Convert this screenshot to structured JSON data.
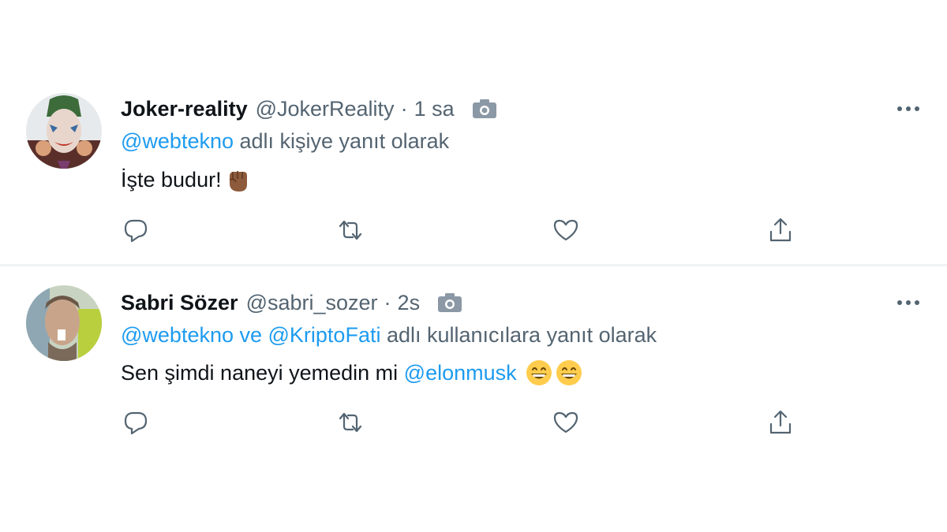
{
  "colors": {
    "link": "#1d9bf0",
    "secondary_text": "#536471",
    "primary_text": "#0f1419",
    "divider": "#eff3f4"
  },
  "tweets": [
    {
      "display_name": "Joker-reality",
      "handle": "@JokerReality",
      "separator": "·",
      "time": "1 sa",
      "reply_mentions": "@webtekno",
      "reply_suffix": " adlı kişiye yanıt olarak",
      "text": "İşte budur!",
      "text_mention": "",
      "emojis": [
        "raised-fist-medium-dark-skin"
      ],
      "icons": [
        "camera-icon",
        "more-icon",
        "reply-icon",
        "retweet-icon",
        "like-icon",
        "share-icon"
      ]
    },
    {
      "display_name": "Sabri Sözer",
      "handle": "@sabri_sozer",
      "separator": "·",
      "time": "2s",
      "reply_mentions": "@webtekno ve @KriptoFati",
      "reply_suffix": " adlı kullanıcılara yanıt olarak",
      "text": "Sen şimdi naneyi yemedin mi ",
      "text_mention": "@elonmusk",
      "emojis": [
        "grinning-face-smiling-eyes",
        "grinning-face-smiling-eyes"
      ],
      "icons": [
        "camera-icon",
        "more-icon",
        "reply-icon",
        "retweet-icon",
        "like-icon",
        "share-icon"
      ]
    }
  ]
}
